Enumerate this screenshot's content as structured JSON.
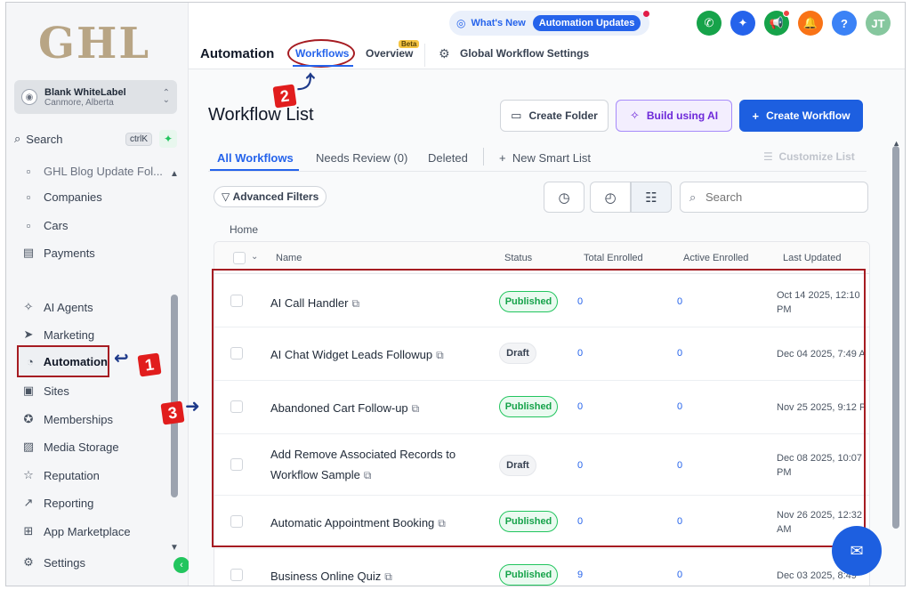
{
  "sidebar": {
    "logo": "GHL",
    "account": {
      "name": "Blank WhiteLabel",
      "location": "Canmore, Alberta"
    },
    "search": {
      "label": "Search",
      "shortcut": "ctrlK"
    },
    "items": [
      {
        "label": "GHL Blog Update Fol...",
        "icon": "doc-icon"
      },
      {
        "label": "Companies",
        "icon": "building-icon"
      },
      {
        "label": "Cars",
        "icon": "car-icon"
      },
      {
        "label": "Payments",
        "icon": "payments-icon"
      },
      {
        "label": "AI Agents",
        "icon": "sparkle-icon"
      },
      {
        "label": "Marketing",
        "icon": "send-icon"
      },
      {
        "label": "Automation",
        "icon": "automation-icon"
      },
      {
        "label": "Sites",
        "icon": "sites-icon"
      },
      {
        "label": "Memberships",
        "icon": "badge-icon"
      },
      {
        "label": "Media Storage",
        "icon": "image-icon"
      },
      {
        "label": "Reputation",
        "icon": "star-icon"
      },
      {
        "label": "Reporting",
        "icon": "chart-icon"
      },
      {
        "label": "App Marketplace",
        "icon": "grid-icon"
      },
      {
        "label": "Settings",
        "icon": "gear-icon"
      }
    ]
  },
  "header": {
    "whats_new": "What's New",
    "automation_updates": "Automation Updates",
    "title": "Automation",
    "tabs": {
      "workflows": "Workflows",
      "overview": "Overview",
      "beta": "Beta",
      "global_settings": "Global Workflow Settings"
    },
    "avatar_initials": "JT",
    "icon_colors": {
      "phone": "#16a34a",
      "ai": "#2563eb",
      "megaphone": "#16a34a",
      "bell": "#f97316",
      "help": "#3b82f6",
      "avatar": "#86c79e"
    }
  },
  "annotations": {
    "one": "1",
    "two": "2",
    "three": "3"
  },
  "main": {
    "page_title": "Workflow List",
    "buttons": {
      "create_folder": "Create Folder",
      "build_ai": "Build using AI",
      "create_workflow": "Create Workflow"
    },
    "subtabs": {
      "all": "All Workflows",
      "review": "Needs Review (0)",
      "deleted": "Deleted",
      "smart_list": "New Smart List",
      "customize": "Customize List"
    },
    "advanced_filters": "Advanced Filters",
    "search_placeholder": "Search",
    "breadcrumb": "Home",
    "columns": {
      "name": "Name",
      "status": "Status",
      "total": "Total Enrolled",
      "active": "Active Enrolled",
      "updated": "Last Updated"
    },
    "rows": [
      {
        "name": "AI Call Handler",
        "status": "Published",
        "total": "0",
        "active": "0",
        "updated": "Oct 14 2025, 12:10 PM"
      },
      {
        "name": "AI Chat Widget Leads Followup",
        "status": "Draft",
        "total": "0",
        "active": "0",
        "updated": "Dec 04 2025, 7:49 A"
      },
      {
        "name": "Abandoned Cart Follow-up",
        "status": "Published",
        "total": "0",
        "active": "0",
        "updated": "Nov 25 2025, 9:12 P"
      },
      {
        "name_line1": "Add Remove Associated Records to",
        "name_line2": "Workflow Sample",
        "status": "Draft",
        "total": "0",
        "active": "0",
        "updated": "Dec 08 2025, 10:07 PM"
      },
      {
        "name": "Automatic Appointment Booking",
        "status": "Published",
        "total": "0",
        "active": "0",
        "updated": "Nov 26 2025, 12:32 AM"
      },
      {
        "name": "Business Online Quiz",
        "status": "Published",
        "total": "9",
        "active": "0",
        "updated": "Dec 03 2025, 8:49"
      }
    ]
  }
}
